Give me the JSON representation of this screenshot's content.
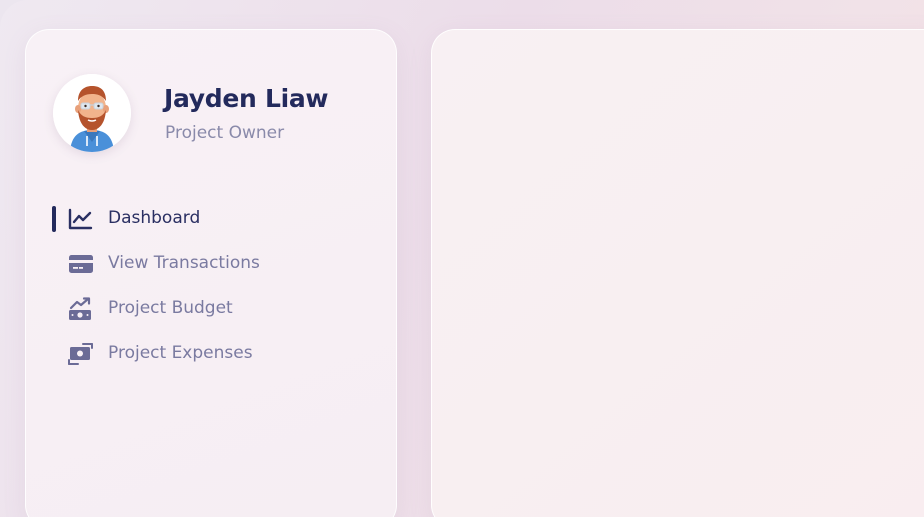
{
  "profile": {
    "name": "Jayden Liaw",
    "role": "Project Owner",
    "avatar_icon": "bearded-man-avatar"
  },
  "nav": {
    "items": [
      {
        "label": "Dashboard",
        "icon": "line-chart-icon",
        "active": true
      },
      {
        "label": "View Transactions",
        "icon": "credit-card-icon",
        "active": false
      },
      {
        "label": "Project Budget",
        "icon": "money-growth-icon",
        "active": false
      },
      {
        "label": "Project Expenses",
        "icon": "money-exchange-icon",
        "active": false
      }
    ]
  },
  "colors": {
    "primary_text": "#232a5c",
    "muted_text": "#7a7aa0",
    "icon_color": "#6b6b96"
  }
}
